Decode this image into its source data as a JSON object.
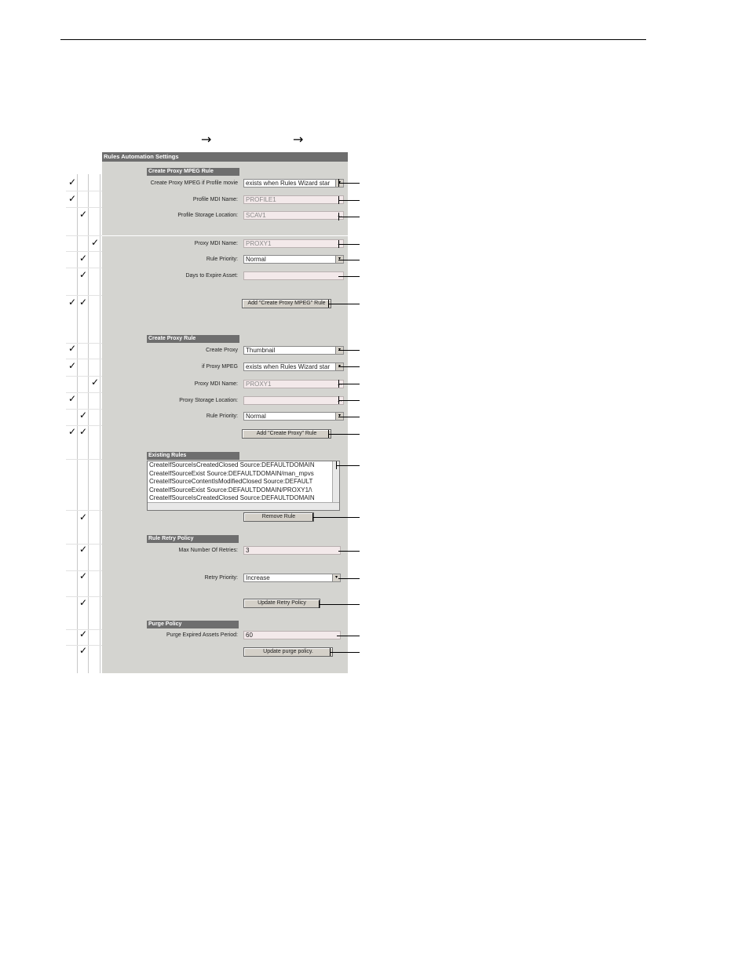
{
  "panel_title": "Rules Automation Settings",
  "arrows": [
    "→",
    "→"
  ],
  "checkmark": "✓",
  "proxy_mpeg": {
    "header": "Create Proxy MPEG Rule",
    "create_label": "Create Proxy MPEG if Profile movie",
    "create_value": "exists when Rules Wizard star",
    "profile_mdi_label": "Profile MDI Name:",
    "profile_mdi_value": "PROFILE1",
    "profile_storage_label": "Profile Storage Location:",
    "profile_storage_value": "SCAV1",
    "proxy_mdi_label": "Proxy MDI Name:",
    "proxy_mdi_value": "PROXY1",
    "priority_label": "Rule Priority:",
    "priority_value": "Normal",
    "days_label": "Days to Expire Asset:",
    "days_value": "",
    "add_button": "Add \"Create Proxy MPEG\" Rule"
  },
  "proxy": {
    "header": "Create Proxy Rule",
    "create_label": "Create Proxy",
    "create_value": "Thumbnail",
    "if_label": "if Proxy MPEG",
    "if_value": "exists when Rules Wizard star",
    "proxy_mdi_label": "Proxy MDI Name:",
    "proxy_mdi_value": "PROXY1",
    "storage_label": "Proxy Storage Location:",
    "storage_value": "",
    "priority_label": "Rule Priority:",
    "priority_value": "Normal",
    "add_button": "Add \"Create Proxy\" Rule"
  },
  "existing": {
    "header": "Existing Rules",
    "items": [
      "CreateIfSourceIsCreatedClosed Source:DEFAULTDOMAIN",
      "CreateIfSourceExist Source:DEFAULTDOMAIN/man_mpvs",
      "CreateIfSourceContentIsModifiedClosed Source:DEFAULT",
      "CreateIfSourceExist Source:DEFAULTDOMAIN/PROXY1/\\",
      "CreateIfSourceIsCreatedClosed Source:DEFAULTDOMAIN"
    ],
    "remove_button": "Remove Rule"
  },
  "retry": {
    "header": "Rule Retry Policy",
    "max_label": "Max Number Of Retries:",
    "max_value": "3",
    "priority_label": "Retry Priority:",
    "priority_value": "Increase",
    "update_button": "Update Retry Policy"
  },
  "purge": {
    "header": "Purge Policy",
    "period_label": "Purge Expired Assets Period:",
    "period_value": "60",
    "update_button": "Update purge policy."
  }
}
